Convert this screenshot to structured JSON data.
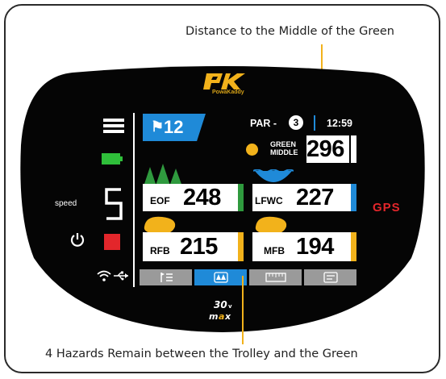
{
  "callouts": {
    "top": "Distance to the Middle of the Green",
    "bottom": "4 Hazards Remain between the Trolley and the Green"
  },
  "brand": {
    "logo_text": "PK",
    "logo_subtext": "PowaKaddy",
    "model": "30v MAX"
  },
  "side_panel": {
    "speed_label": "speed",
    "speed_value": "5",
    "gps_label": "GPS"
  },
  "header": {
    "hole_number": "12",
    "par_label": "PAR -",
    "par_value": "3",
    "time": "12:59"
  },
  "green": {
    "label_line1": "GREEN",
    "label_line2": "MIDDLE",
    "distance": "296"
  },
  "hazards": [
    {
      "label": "EOF",
      "distance": "248",
      "bar_color": "#2f9a3e",
      "icon": "trees-icon"
    },
    {
      "label": "LFWC",
      "distance": "227",
      "bar_color": "#1f8ad8",
      "icon": "water-icon"
    },
    {
      "label": "RFB",
      "distance": "215",
      "bar_color": "#f2b21b",
      "icon": "bunker-icon"
    },
    {
      "label": "MFB",
      "distance": "194",
      "bar_color": "#f2b21b",
      "icon": "bunker-icon"
    }
  ],
  "tabs": [
    {
      "icon": "hole-list-icon",
      "active": false
    },
    {
      "icon": "hazards-icon",
      "active": true
    },
    {
      "icon": "ruler-icon",
      "active": false
    },
    {
      "icon": "scorecard-icon",
      "active": false
    }
  ],
  "colors": {
    "accent_blue": "#1f8ad8",
    "hazard_yellow": "#f2b21b",
    "battery_green": "#2fbf3a",
    "stop_red": "#e3262b"
  }
}
